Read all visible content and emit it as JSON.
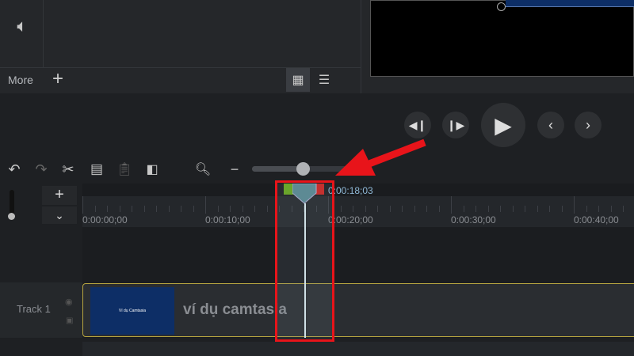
{
  "media_panel": {
    "more_label": "More",
    "add_label": "+"
  },
  "timeline": {
    "playhead_time": "0:00:18;03",
    "ruler_labels": [
      "0:00:00;00",
      "0:00:10;00",
      "0:00:20;00",
      "0:00:30;00",
      "0:00:40;00"
    ],
    "zoom_fraction": 0.8
  },
  "tracks": [
    {
      "name": "Track 1",
      "clip_title": "ví dụ camtasla",
      "thumb_text": "Ví dụ Camtasia"
    }
  ],
  "colors": {
    "annotation": "#e8141a",
    "clip_border": "#b8a640",
    "thumb_bg": "#0d2e66",
    "playhead": "#5d8a94"
  }
}
